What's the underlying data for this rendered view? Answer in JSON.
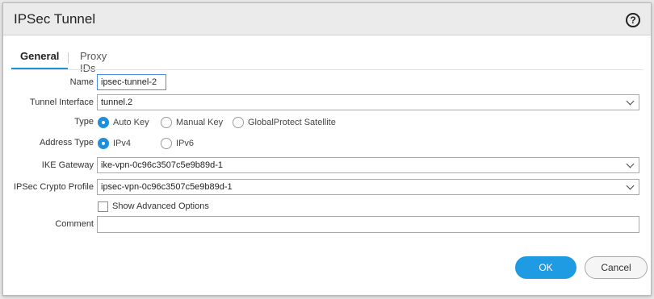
{
  "dialog": {
    "title": "IPSec Tunnel",
    "help_icon": "?"
  },
  "tabs": [
    {
      "label": "General",
      "active": true
    },
    {
      "label": "Proxy IDs",
      "active": false
    }
  ],
  "form": {
    "name": {
      "label": "Name",
      "value": "ipsec-tunnel-2"
    },
    "tunnel_interface": {
      "label": "Tunnel Interface",
      "value": "tunnel.2"
    },
    "type": {
      "label": "Type",
      "options": [
        {
          "label": "Auto Key",
          "checked": true
        },
        {
          "label": "Manual Key",
          "checked": false
        },
        {
          "label": "GlobalProtect Satellite",
          "checked": false
        }
      ]
    },
    "address_type": {
      "label": "Address Type",
      "options": [
        {
          "label": "IPv4",
          "checked": true
        },
        {
          "label": "IPv6",
          "checked": false
        }
      ]
    },
    "ike_gateway": {
      "label": "IKE Gateway",
      "value": "ike-vpn-0c96c3507c5e9b89d-1"
    },
    "ipsec_crypto_profile": {
      "label": "IPSec Crypto Profile",
      "value": "ipsec-vpn-0c96c3507c5e9b89d-1"
    },
    "show_advanced": {
      "label": "Show Advanced Options",
      "checked": false
    },
    "comment": {
      "label": "Comment",
      "value": ""
    }
  },
  "buttons": {
    "ok": "OK",
    "cancel": "Cancel"
  },
  "colors": {
    "accent": "#1f9be4",
    "tab_underline": "#1f8fd5",
    "titlebar": "#ebebeb"
  }
}
